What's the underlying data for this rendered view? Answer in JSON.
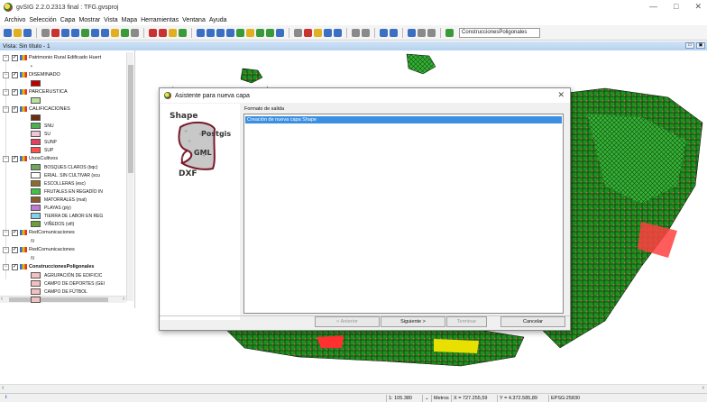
{
  "window": {
    "title": "gvSIG 2.2.0.2313 final : TFG.gvsproj",
    "controls": {
      "minimize": "—",
      "maximize": "□",
      "close": "✕"
    }
  },
  "menubar": [
    "Archivo",
    "Selección",
    "Capa",
    "Mostrar",
    "Vista",
    "Mapa",
    "Herramientas",
    "Ventana",
    "Ayuda"
  ],
  "toolbar": {
    "current_layer": "ConstruccionesPoligonales",
    "colors": {
      "blue": "#3a6fc4",
      "green": "#3a9a3a",
      "red": "#c83232",
      "yellow": "#e0b020",
      "gray": "#8a8a8a"
    }
  },
  "view": {
    "title": "Vista: Sin título - 1",
    "btn_minimize": "▭",
    "btn_maximize": "▣"
  },
  "toc": {
    "layers": [
      {
        "name": "Patrimonio Rural Edificado Huert",
        "symbol": "•"
      },
      {
        "name": "DISEMINADO",
        "color": "#c00000"
      },
      {
        "name": "PARCERUSTICA",
        "color": "#b8e0a0"
      },
      {
        "name": "CALIFICACIONES",
        "legend": [
          {
            "label": "",
            "color": "#6b2e0e"
          },
          {
            "label": "SNU",
            "color": "#4caf50"
          },
          {
            "label": "SU",
            "color": "#f3c4d6"
          },
          {
            "label": "SUNP",
            "color": "#e54060"
          },
          {
            "label": "SUP",
            "color": "#ff5050"
          }
        ]
      },
      {
        "name": "UsosCultivos",
        "legend": [
          {
            "label": "BOSQUES CLAROS (bqc)",
            "color": "#6fa85a"
          },
          {
            "label": "ERIAL. SIN CULTIVAR (scu",
            "color": "#ffffff"
          },
          {
            "label": "ESCOLLERAS (esc)",
            "color": "#8b6d2f"
          },
          {
            "label": "FRUTALES EN REGADÍO IN",
            "color": "#3ec43e"
          },
          {
            "label": "MATORRALES (mat)",
            "color": "#8d5a2a"
          },
          {
            "label": "PLAYAS (ply)",
            "color": "#c07ad0"
          },
          {
            "label": "TIERRA DE LABOR EN REG",
            "color": "#84d0e8"
          },
          {
            "label": "VIÑEDOS (vifi)",
            "color": "#6aa03a"
          }
        ]
      },
      {
        "name": "RedComunicaciones",
        "symbol": "/\\/"
      },
      {
        "name": "RedComunicaciones",
        "symbol": "/\\/"
      },
      {
        "name": "ConstruccionesPoligonales",
        "bold": true,
        "legend": [
          {
            "label": "AGRUPACIÓN DE EDIFICIC",
            "color": "#f3c0c0"
          },
          {
            "label": "CAMPO DE DEPORTES (GEI",
            "color": "#f3c0c0"
          },
          {
            "label": "CAMPO DE FÚTBOL",
            "color": "#f3c0c0"
          },
          {
            "label": "",
            "color": "#f3c0c0"
          }
        ]
      }
    ]
  },
  "dialog": {
    "title": "Asistente para nueva capa",
    "close": "✕",
    "illustration": {
      "shape": "Shape",
      "postgis": "Postgis",
      "gml": "GML",
      "dxf": "DXF"
    },
    "format_label": "Formato de salida",
    "options": [
      "Creación de nueva capa Shape"
    ],
    "buttons": {
      "prev": "< Anterior",
      "next": "Siguiente >",
      "finish": "Terminar",
      "cancel": "Cancelar"
    }
  },
  "statusbar": {
    "info": "i",
    "scale": "1: 105.380",
    "units": "Metros",
    "x": "X = 727.255,59",
    "y": "Y = 4.372.585,89",
    "epsg": "EPSG:25830"
  }
}
